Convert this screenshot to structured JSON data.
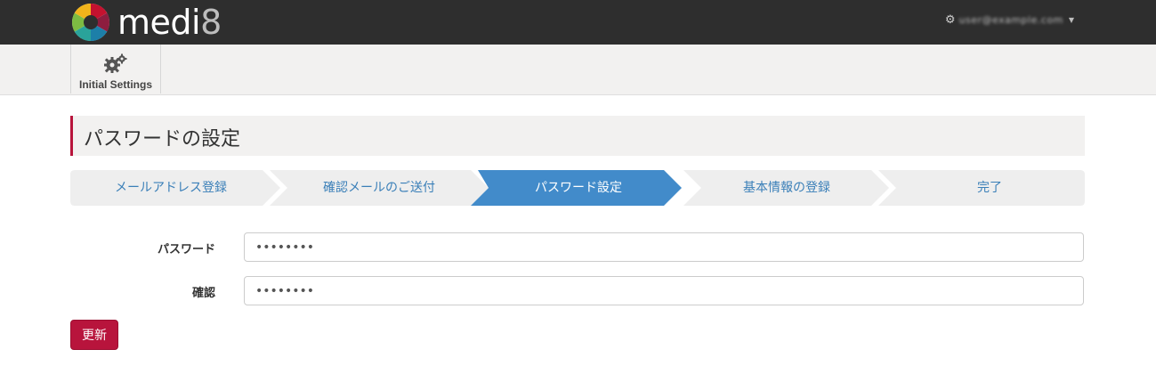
{
  "header": {
    "logo_text": "medi",
    "logo_suffix": "8",
    "user_name": "user@example.com"
  },
  "subnav": {
    "items": [
      {
        "label": "Initial Settings",
        "icon": "gears-icon"
      }
    ]
  },
  "page": {
    "title": "パスワードの設定"
  },
  "steps": [
    {
      "label": "メールアドレス登録",
      "active": false
    },
    {
      "label": "確認メールのご送付",
      "active": false
    },
    {
      "label": "パスワード設定",
      "active": true
    },
    {
      "label": "基本情報の登録",
      "active": false
    },
    {
      "label": "完了",
      "active": false
    }
  ],
  "form": {
    "password_label": "パスワード",
    "password_value": "••••••••",
    "confirm_label": "確認",
    "confirm_value": "••••••••",
    "submit_label": "更新"
  },
  "colors": {
    "topbar": "#2e2e2e",
    "accent": "#b8143c",
    "step_active": "#428bca",
    "step_inactive": "#eeeeee",
    "step_text": "#3a7fb8"
  }
}
